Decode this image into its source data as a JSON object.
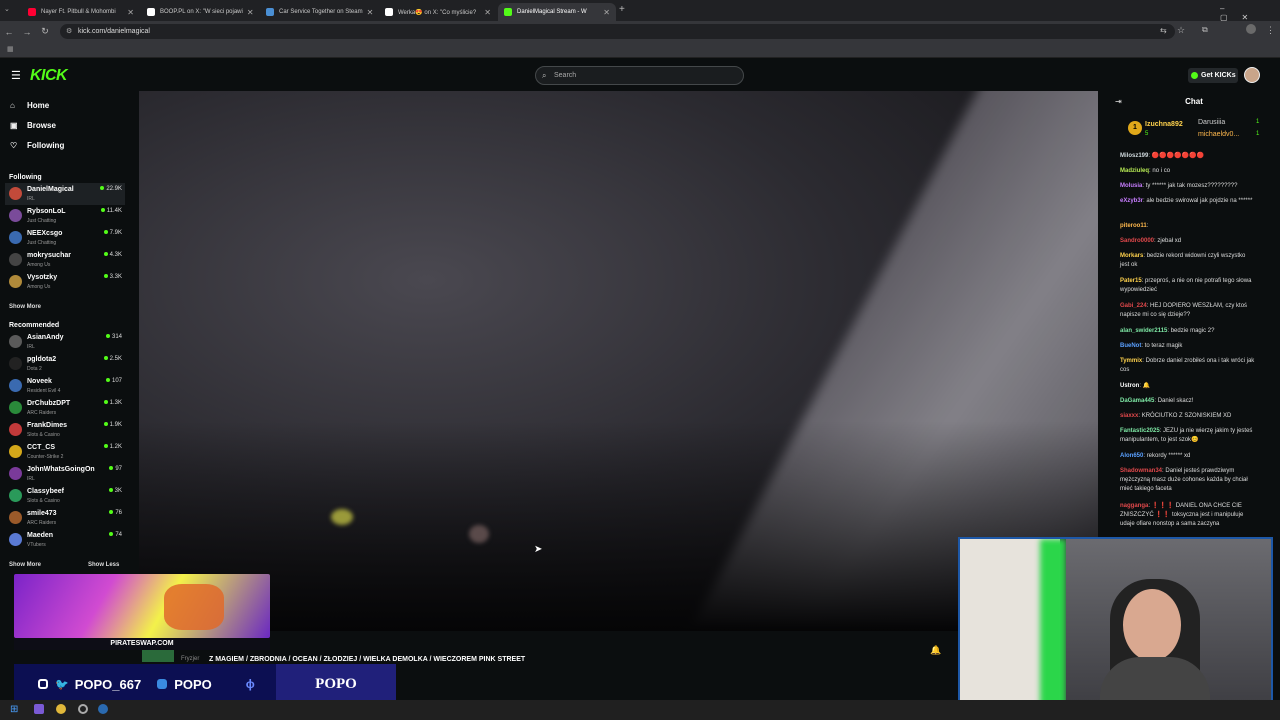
{
  "browser": {
    "tabs": [
      {
        "title": "Nayer Ft. Pitbull & Mohombi",
        "fav_color": "#ff0033",
        "active": false
      },
      {
        "title": "BOOP.PL on X: \"W sieci pojawi",
        "fav_color": "#ffffff",
        "active": false
      },
      {
        "title": "Car Service Together on Steam",
        "fav_color": "#4a8fd4",
        "active": false
      },
      {
        "title": "Werka😍 on X: \"Co myślicie? ",
        "fav_color": "#ffffff",
        "active": false
      },
      {
        "title": "DanielMagical Stream - W",
        "fav_color": "#53fc18",
        "active": true
      }
    ],
    "url": "kick.com/danielmagical"
  },
  "header": {
    "logo": "KICK",
    "search_placeholder": "Search",
    "get_kicks": "Get KICKs"
  },
  "sidebar": {
    "nav": [
      {
        "label": "Home",
        "icon": "home-icon"
      },
      {
        "label": "Browse",
        "icon": "browse-icon"
      },
      {
        "label": "Following",
        "icon": "heart-icon"
      }
    ],
    "following_title": "Following",
    "following": [
      {
        "name": "DanielMagical",
        "category": "IRL",
        "viewers": "22.9K",
        "color": "#c24a3a"
      },
      {
        "name": "RybsonLoL",
        "category": "Just Chatting",
        "viewers": "11.4K",
        "color": "#7a4b9a"
      },
      {
        "name": "NEEXcsgo",
        "category": "Just Chatting",
        "viewers": "7.9K",
        "color": "#3a6ab0"
      },
      {
        "name": "mokrysuchar",
        "category": "Among Us",
        "viewers": "4.3K",
        "color": "#444"
      },
      {
        "name": "Vysotzky",
        "category": "Among Us",
        "viewers": "3.3K",
        "color": "#b08a3a"
      }
    ],
    "show_more_1": "Show More",
    "recommended_title": "Recommended",
    "recommended": [
      {
        "name": "AsianAndy",
        "category": "IRL",
        "viewers": "314",
        "color": "#5a5a5a"
      },
      {
        "name": "pgldota2",
        "category": "Dota 2",
        "viewers": "2.5K",
        "color": "#222"
      },
      {
        "name": "Noveek",
        "category": "Resident Evil 4",
        "viewers": "107",
        "color": "#3a6ab0"
      },
      {
        "name": "DrChubzDPT",
        "category": "ARC Raiders",
        "viewers": "1.3K",
        "color": "#2a8a3a"
      },
      {
        "name": "FrankDimes",
        "category": "Slots & Casino",
        "viewers": "1.9K",
        "color": "#c23a3a"
      },
      {
        "name": "CCT_CS",
        "category": "Counter-Strike 2",
        "viewers": "1.2K",
        "color": "#d4a81a"
      },
      {
        "name": "JohnWhatsGoingOn",
        "category": "IRL",
        "viewers": "97",
        "color": "#7a3a9a"
      },
      {
        "name": "Classybeef",
        "category": "Slots & Casino",
        "viewers": "3K",
        "color": "#2a9a5a"
      },
      {
        "name": "smile473",
        "category": "ARC Raiders",
        "viewers": "76",
        "color": "#9a5a2a"
      },
      {
        "name": "Maeden",
        "category": "VTubers",
        "viewers": "74",
        "color": "#5a7ad4"
      }
    ],
    "show_more_2": "Show More",
    "show_less": "Show Less"
  },
  "overlay": {
    "ad_label": "PIRATESWAP.COM",
    "social_1": "POPO_667",
    "social_2": "POPO",
    "popo_box": "POPO"
  },
  "stream_info": {
    "title": "Z MAGIEM / ZBRODNIA / OCEAN / ZŁODZIEJ / WIELKA DEMOLKA / WIECZOREM PINK STREET",
    "title_prefix": "Fryzjer"
  },
  "chat": {
    "title": "Chat",
    "pinned": [
      {
        "name": "Izuchna892",
        "badge": "5",
        "rank": "1"
      },
      {
        "name": "Darusiiia",
        "count": "1"
      },
      {
        "name": "michaeldv0...",
        "count": "1"
      }
    ],
    "messages": [
      {
        "user": "Milosz199",
        "color": "#cfd8dc",
        "text": "🔴🔴🔴🔴🔴🔴🔴"
      },
      {
        "user": "Madziuleq",
        "color": "#b5e853",
        "text": "no i co"
      },
      {
        "user": "Molusia",
        "color": "#c77dff",
        "text": "ty ****** jak tak mozesz?????????"
      },
      {
        "user": "eXzyb3r",
        "color": "#c77dff",
        "text": "ale bedzie swirowal jak pojdzie na ******"
      },
      {
        "user": "piteroo11",
        "color": "#ffb84d",
        "text": ""
      },
      {
        "user": "Sandro0000",
        "color": "#e0484b",
        "text": "zjebał xd"
      },
      {
        "user": "Morkars",
        "color": "#ffd24d",
        "text": "bedzie rekord widowni czyli wszystko jest ok"
      },
      {
        "user": "Pater15",
        "color": "#ffd24d",
        "text": "przeproś, a nie on nie potrafi tego słowa wypowiedzieć"
      },
      {
        "user": "Gabi_224",
        "color": "#e0484b",
        "text": "HEJ DOPIERO WESZŁAM, czy ktoś napisze mi co się dzieje??"
      },
      {
        "user": "alan_swider2115",
        "color": "#7ee8a5",
        "text": "bedzie magic 2?"
      },
      {
        "user": "BueNot",
        "color": "#5aa0ff",
        "text": "to teraz magik"
      },
      {
        "user": "Tymmix",
        "color": "#ffd24d",
        "text": "Dobrze daniel zrobiłeś ona i tak wróci jak cos"
      },
      {
        "user": "Ustron",
        "color": "#ffffff",
        "text": "🔔"
      },
      {
        "user": "DaGama445",
        "color": "#7ee8a5",
        "text": "Daniel skacz!"
      },
      {
        "user": "siaxxx",
        "color": "#e0484b",
        "text": "KRÓCIUTKO Z SZONISKIEM XD"
      },
      {
        "user": "Fantastic2025",
        "color": "#7ee8a5",
        "text": "JEZU ja nie wierzę jakim ty jesteś manipulantem, to jest szok😊"
      },
      {
        "user": "Alon650",
        "color": "#5aa0ff",
        "text": "rekordy ****** xd"
      },
      {
        "user": "Shadowman34",
        "color": "#e0484b",
        "text": "Daniel jesteś prawdziwym mężczyzną masz duże cohones każda by chciał mieć takiego faceta"
      },
      {
        "user": "nagganga",
        "color": "#e0484b",
        "text": "❗❗❗ DANIEL ONA CHCE CIE ZNISZCZYĆ ❗❗ toksyczna jest i manipuluje udaje ofiare nonstop a sama zaczyna"
      }
    ]
  }
}
